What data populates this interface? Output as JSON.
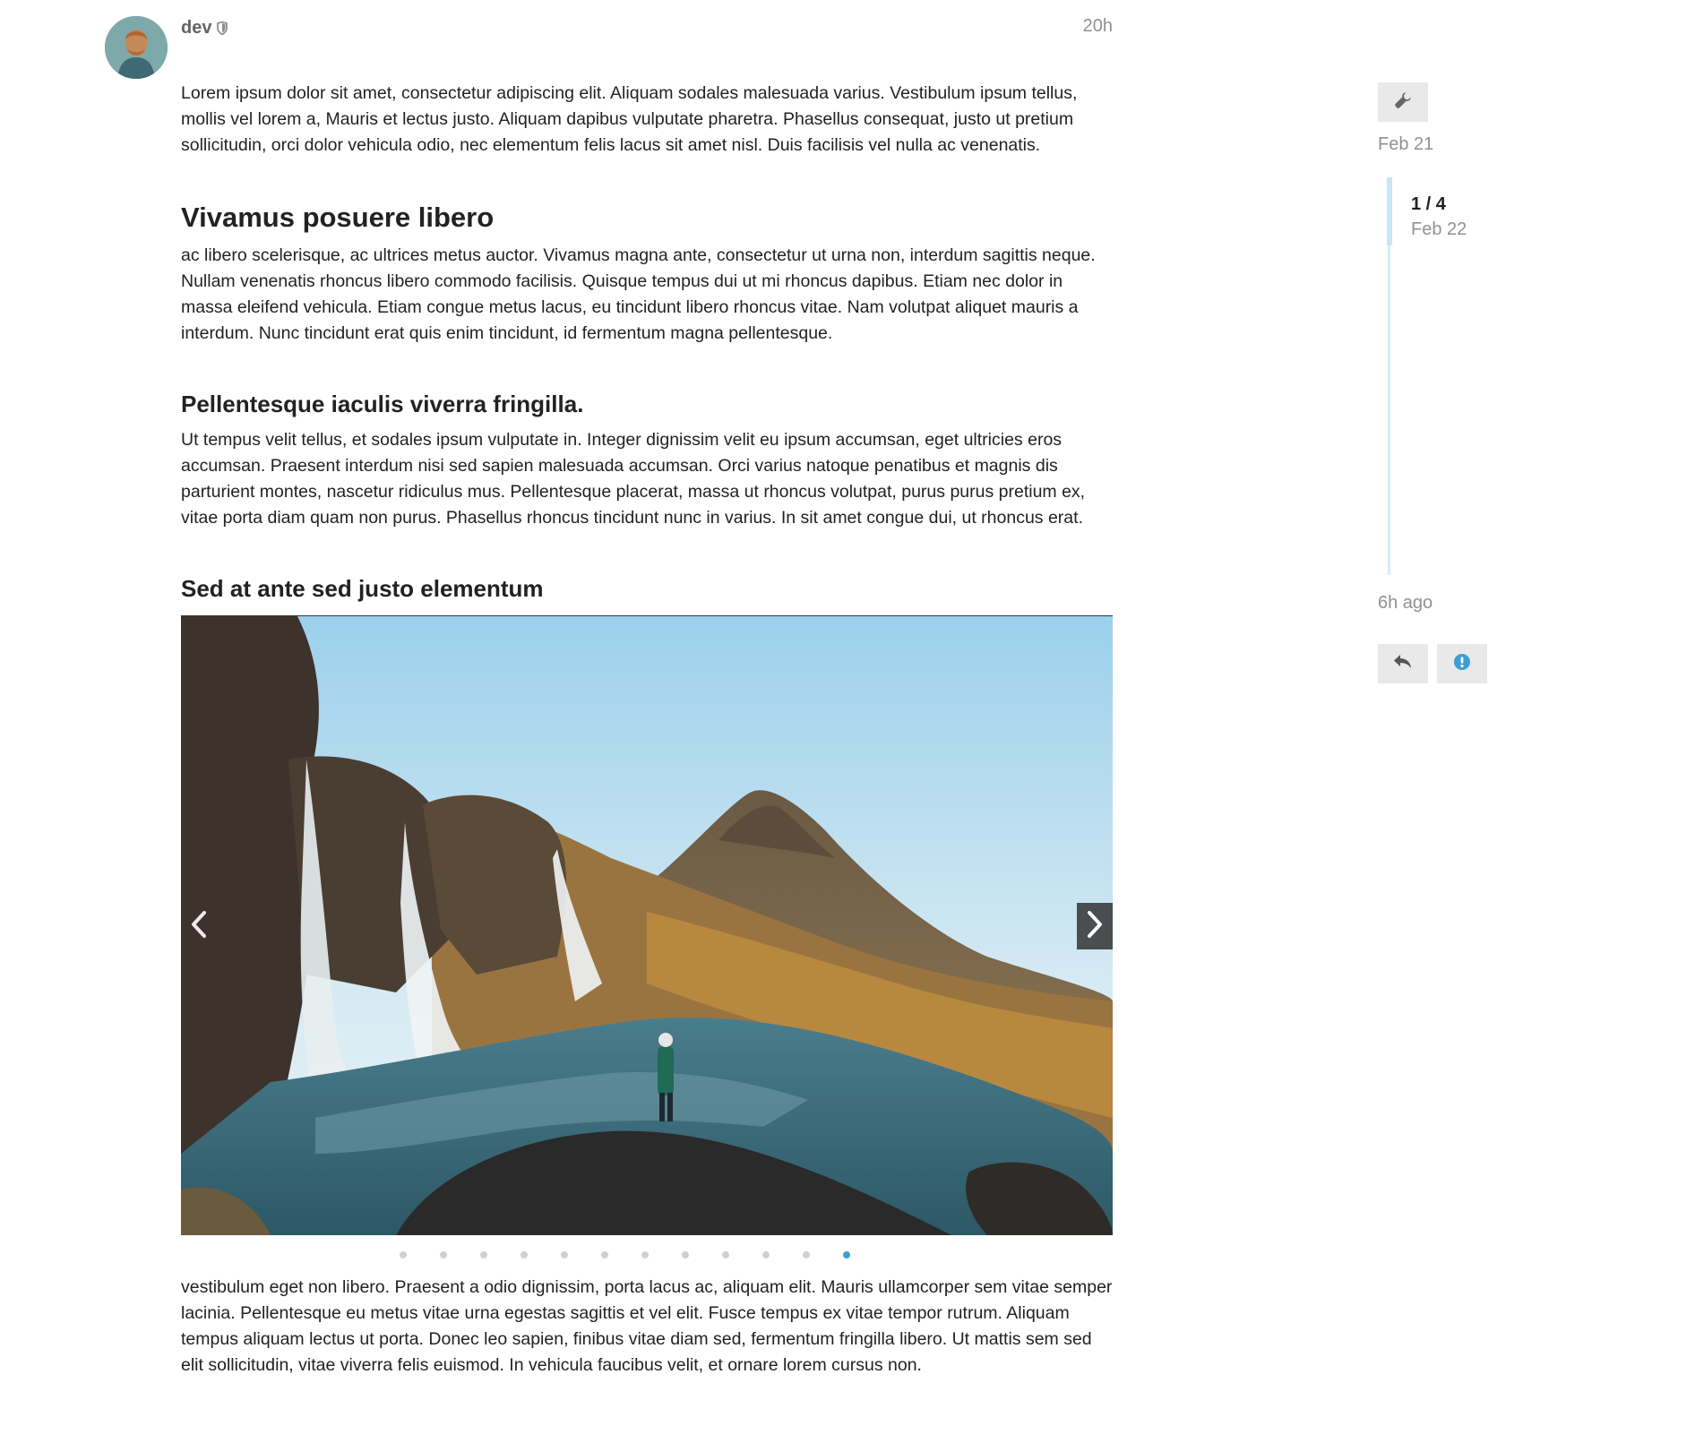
{
  "post": {
    "username": "dev",
    "relative_time": "20h",
    "paragraphs": {
      "intro": "Lorem ipsum dolor sit amet, consectetur adipiscing elit. Aliquam sodales malesuada varius. Vestibulum ipsum tellus, mollis vel lorem a, Mauris et lectus justo. Aliquam dapibus vulputate pharetra. Phasellus consequat, justo ut pretium sollicitudin, orci dolor vehicula odio, nec elementum felis lacus sit amet nisl. Duis facilisis vel nulla ac venenatis.",
      "section1": "ac libero scelerisque, ac ultrices metus auctor. Vivamus magna ante, consectetur ut urna non, interdum sagittis neque. Nullam venenatis rhoncus libero commodo facilisis. Quisque tempus dui ut mi rhoncus dapibus. Etiam nec dolor in massa eleifend vehicula. Etiam congue metus lacus, eu tincidunt libero rhoncus vitae. Nam volutpat aliquet mauris a interdum. Nunc tincidunt erat quis enim tincidunt, id fermentum magna pellentesque.",
      "section2": "Ut tempus velit tellus, et sodales ipsum vulputate in. Integer dignissim velit eu ipsum accumsan, eget ultricies eros accumsan. Praesent interdum nisi sed sapien malesuada accumsan. Orci varius natoque penatibus et magnis dis parturient montes, nascetur ridiculus mus. Pellentesque placerat, massa ut rhoncus volutpat, purus purus pretium ex, vitae porta diam quam non purus. Phasellus rhoncus tincidunt nunc in varius. In sit amet congue dui, ut rhoncus erat.",
      "outro": "vestibulum eget non libero. Praesent a odio dignissim, porta lacus ac, aliquam elit. Mauris ullamcorper sem vitae semper lacinia. Pellentesque eu metus vitae urna egestas sagittis et vel elit. Fusce tempus ex vitae tempor rutrum. Aliquam tempus aliquam lectus ut porta. Donec leo sapien, finibus vitae diam sed, fermentum fringilla libero. Ut mattis sem sed elit sollicitudin, vitae viverra felis euismod. In vehicula faucibus velit, et ornare lorem cursus non."
    },
    "headings": {
      "h2": "Vivamus posuere libero",
      "h3a": "Pellentesque iaculis viverra fringilla.",
      "h3b": "Sed at ante sed justo elementum"
    }
  },
  "gallery": {
    "total_slides": 12,
    "active_slide": 12
  },
  "timeline": {
    "top_date": "Feb 21",
    "position": "1 / 4",
    "position_date": "Feb 22",
    "bottom_label": "6h ago"
  },
  "icons": {
    "admin": "wrench-icon",
    "reply": "reply-icon",
    "notification": "exclamation-circle-icon",
    "moderator": "shield-icon",
    "prev": "chevron-left-icon",
    "next": "chevron-right-icon"
  },
  "colors": {
    "accent": "#3a9fd8",
    "muted": "#919191",
    "button_bg": "#e9e9e9",
    "timeline_track": "#d6eef8"
  }
}
